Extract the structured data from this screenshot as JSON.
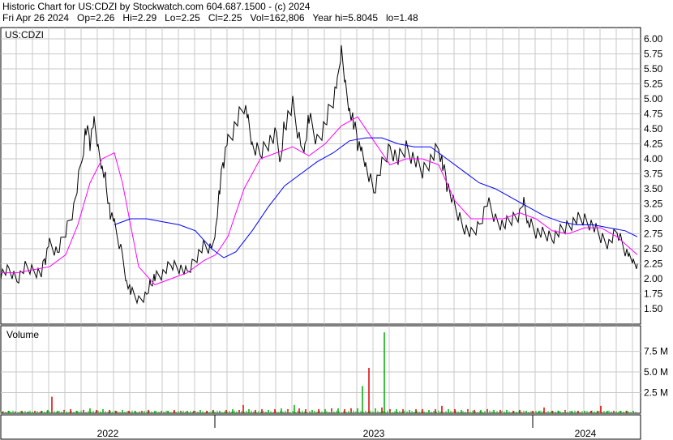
{
  "header": {
    "line1": "Historic Chart for US:CDZI by Stockwatch.com 604.687.1500 - (c) 2024",
    "line2": "Fri Apr 26 2024   Op=2.26   Hi=2.29   Lo=2.25   Cl=2.25   Vol=162,806   Year hi=5.8045   lo=1.48"
  },
  "chart_data": [
    {
      "type": "line",
      "panel": "price",
      "symbol_label": "US:CDZI",
      "ylim": [
        1.25,
        6.1
      ],
      "y_ticks": [
        "6.00",
        "5.75",
        "5.50",
        "5.25",
        "5.00",
        "4.75",
        "4.50",
        "4.25",
        "4.00",
        "3.75",
        "3.50",
        "3.25",
        "3.00",
        "2.75",
        "2.50",
        "2.25",
        "2.00",
        "1.75",
        "1.50"
      ],
      "x_labels": [
        "2022",
        "2023",
        "2024"
      ],
      "grid": true,
      "colors": {
        "price": "#000000",
        "ma_short": "#ff00ff",
        "ma_long": "#0000ff"
      },
      "series": [
        {
          "key": "price",
          "x": [
            0,
            10,
            20,
            30,
            40,
            50,
            55,
            60,
            70,
            80,
            90,
            100,
            105,
            110,
            115,
            120,
            125,
            130,
            135,
            140,
            150,
            155,
            160,
            170,
            180,
            185,
            190,
            200,
            210,
            220,
            230,
            240,
            250,
            260,
            265,
            270,
            275,
            280,
            290,
            300,
            305,
            310,
            320,
            330,
            340,
            345,
            350,
            360,
            370,
            375,
            380,
            390,
            400,
            410,
            415,
            420,
            425,
            430,
            435,
            440,
            445,
            450,
            460,
            470,
            480,
            490,
            500,
            510,
            520,
            530,
            540,
            545,
            550,
            560,
            570,
            580,
            590,
            600,
            610,
            620,
            630,
            640,
            645,
            650,
            660,
            670,
            680,
            690,
            700,
            710,
            720,
            730,
            740,
            750,
            760,
            770,
            775,
            780,
            785
          ],
          "y": [
            2.1,
            2.15,
            2.0,
            2.2,
            2.15,
            2.1,
            2.35,
            2.6,
            2.45,
            2.8,
            3.2,
            4.0,
            4.5,
            4.3,
            4.6,
            4.2,
            3.9,
            3.6,
            3.1,
            2.9,
            2.4,
            2.0,
            1.8,
            1.65,
            1.75,
            1.95,
            2.05,
            2.1,
            2.25,
            2.2,
            2.1,
            2.35,
            2.55,
            2.5,
            2.9,
            3.5,
            4.0,
            4.3,
            4.6,
            4.9,
            4.6,
            4.2,
            4.1,
            4.3,
            4.4,
            4.0,
            4.6,
            4.9,
            4.2,
            4.3,
            4.7,
            4.3,
            4.6,
            5.0,
            5.2,
            5.8,
            5.3,
            4.9,
            4.6,
            4.3,
            4.1,
            3.9,
            3.5,
            3.9,
            4.2,
            4.0,
            4.2,
            4.0,
            3.8,
            4.0,
            4.2,
            3.9,
            3.6,
            3.2,
            2.9,
            2.75,
            2.9,
            3.3,
            3.0,
            2.9,
            3.0,
            3.1,
            3.35,
            3.0,
            2.8,
            2.75,
            2.7,
            2.8,
            2.9,
            3.0,
            3.0,
            2.9,
            2.7,
            2.6,
            2.8,
            2.5,
            2.35,
            2.3,
            2.25
          ]
        },
        {
          "key": "ma_short",
          "x": [
            0,
            20,
            40,
            60,
            80,
            95,
            110,
            125,
            140,
            150,
            160,
            170,
            190,
            210,
            230,
            250,
            265,
            280,
            300,
            320,
            340,
            360,
            380,
            400,
            420,
            440,
            460,
            480,
            500,
            520,
            540,
            560,
            580,
            600,
            620,
            640,
            660,
            680,
            700,
            720,
            740,
            760,
            785
          ],
          "y": [
            2.1,
            2.1,
            2.15,
            2.2,
            2.4,
            2.9,
            3.6,
            4.0,
            4.1,
            3.6,
            2.9,
            2.2,
            1.9,
            2.0,
            2.1,
            2.3,
            2.4,
            2.7,
            3.5,
            4.0,
            4.1,
            4.2,
            4.05,
            4.25,
            4.55,
            4.7,
            4.3,
            3.9,
            4.0,
            4.0,
            3.9,
            3.3,
            3.0,
            3.0,
            3.0,
            3.1,
            3.0,
            2.8,
            2.75,
            2.85,
            2.85,
            2.7,
            2.4
          ]
        },
        {
          "key": "ma_long",
          "x": [
            140,
            160,
            180,
            200,
            220,
            240,
            260,
            275,
            290,
            310,
            330,
            350,
            370,
            390,
            410,
            430,
            450,
            470,
            490,
            510,
            530,
            550,
            570,
            590,
            610,
            630,
            650,
            670,
            690,
            710,
            730,
            750,
            770,
            785
          ],
          "y": [
            2.9,
            3.0,
            3.0,
            2.95,
            2.9,
            2.8,
            2.5,
            2.35,
            2.45,
            2.8,
            3.2,
            3.55,
            3.75,
            3.95,
            4.1,
            4.3,
            4.35,
            4.35,
            4.25,
            4.2,
            4.2,
            4.0,
            3.8,
            3.6,
            3.5,
            3.35,
            3.2,
            3.05,
            2.95,
            2.9,
            2.9,
            2.85,
            2.8,
            2.7
          ]
        }
      ]
    },
    {
      "type": "bar",
      "panel": "volume",
      "title": "Volume",
      "ylim": [
        0,
        10
      ],
      "y_ticks": [
        "7.5 M",
        "5.0 M",
        "2.5 M"
      ],
      "colors": {
        "up": "#00aa00",
        "down": "#dd0000",
        "neutral": "#000000"
      },
      "x": [
        2,
        10,
        18,
        26,
        34,
        42,
        50,
        58,
        63,
        70,
        78,
        86,
        94,
        102,
        110,
        118,
        126,
        134,
        142,
        150,
        158,
        166,
        174,
        182,
        190,
        198,
        206,
        214,
        222,
        230,
        238,
        246,
        254,
        262,
        270,
        278,
        286,
        294,
        299,
        306,
        314,
        322,
        330,
        338,
        346,
        354,
        362,
        368,
        376,
        384,
        392,
        400,
        408,
        416,
        424,
        432,
        440,
        446,
        454,
        462,
        470,
        473,
        480,
        488,
        496,
        504,
        512,
        520,
        528,
        536,
        544,
        552,
        560,
        568,
        576,
        584,
        592,
        600,
        608,
        616,
        624,
        632,
        640,
        648,
        656,
        664,
        670,
        680,
        688,
        696,
        704,
        712,
        720,
        728,
        736,
        740,
        748,
        756,
        764,
        772,
        780
      ],
      "values": [
        0.2,
        0.3,
        0.2,
        0.3,
        0.2,
        0.3,
        0.3,
        0.4,
        2.0,
        0.3,
        0.4,
        0.5,
        0.3,
        0.4,
        0.6,
        0.4,
        0.5,
        0.4,
        0.3,
        0.4,
        0.3,
        0.3,
        0.3,
        0.4,
        0.3,
        0.3,
        0.3,
        0.4,
        0.3,
        0.3,
        0.3,
        0.4,
        0.3,
        0.4,
        0.3,
        0.4,
        0.5,
        0.4,
        1.0,
        0.5,
        0.4,
        0.5,
        0.4,
        0.5,
        0.6,
        0.5,
        1.0,
        0.6,
        0.5,
        0.4,
        0.5,
        0.5,
        0.6,
        0.6,
        0.5,
        0.6,
        0.6,
        3.3,
        5.5,
        0.6,
        0.7,
        9.8,
        0.5,
        0.5,
        0.5,
        0.4,
        0.5,
        0.5,
        0.4,
        0.5,
        0.9,
        0.5,
        0.5,
        0.4,
        0.5,
        0.4,
        0.4,
        0.5,
        0.4,
        0.4,
        0.4,
        0.3,
        0.4,
        0.3,
        0.3,
        0.3,
        0.7,
        0.3,
        0.3,
        0.4,
        0.3,
        0.3,
        0.3,
        0.3,
        0.3,
        0.9,
        0.3,
        0.3,
        0.3,
        0.3,
        0.3
      ],
      "colorsSeq": [
        "d",
        "g",
        "d",
        "d",
        "g",
        "d",
        "d",
        "g",
        "d",
        "g",
        "d",
        "d",
        "g",
        "d",
        "g",
        "d",
        "g",
        "d",
        "d",
        "g",
        "d",
        "g",
        "d",
        "d",
        "g",
        "d",
        "g",
        "d",
        "d",
        "g",
        "d",
        "g",
        "d",
        "d",
        "g",
        "d",
        "g",
        "d",
        "d",
        "g",
        "d",
        "d",
        "g",
        "d",
        "g",
        "d",
        "g",
        "d",
        "d",
        "g",
        "d",
        "g",
        "d",
        "g",
        "d",
        "d",
        "g",
        "g",
        "d",
        "g",
        "d",
        "g",
        "d",
        "g",
        "d",
        "g",
        "d",
        "d",
        "g",
        "d",
        "d",
        "g",
        "d",
        "g",
        "d",
        "d",
        "g",
        "d",
        "g",
        "d",
        "g",
        "d",
        "d",
        "g",
        "d",
        "g",
        "d",
        "d",
        "g",
        "d",
        "g",
        "d",
        "g",
        "d",
        "d",
        "d",
        "g",
        "d",
        "g",
        "d",
        "g"
      ]
    }
  ]
}
